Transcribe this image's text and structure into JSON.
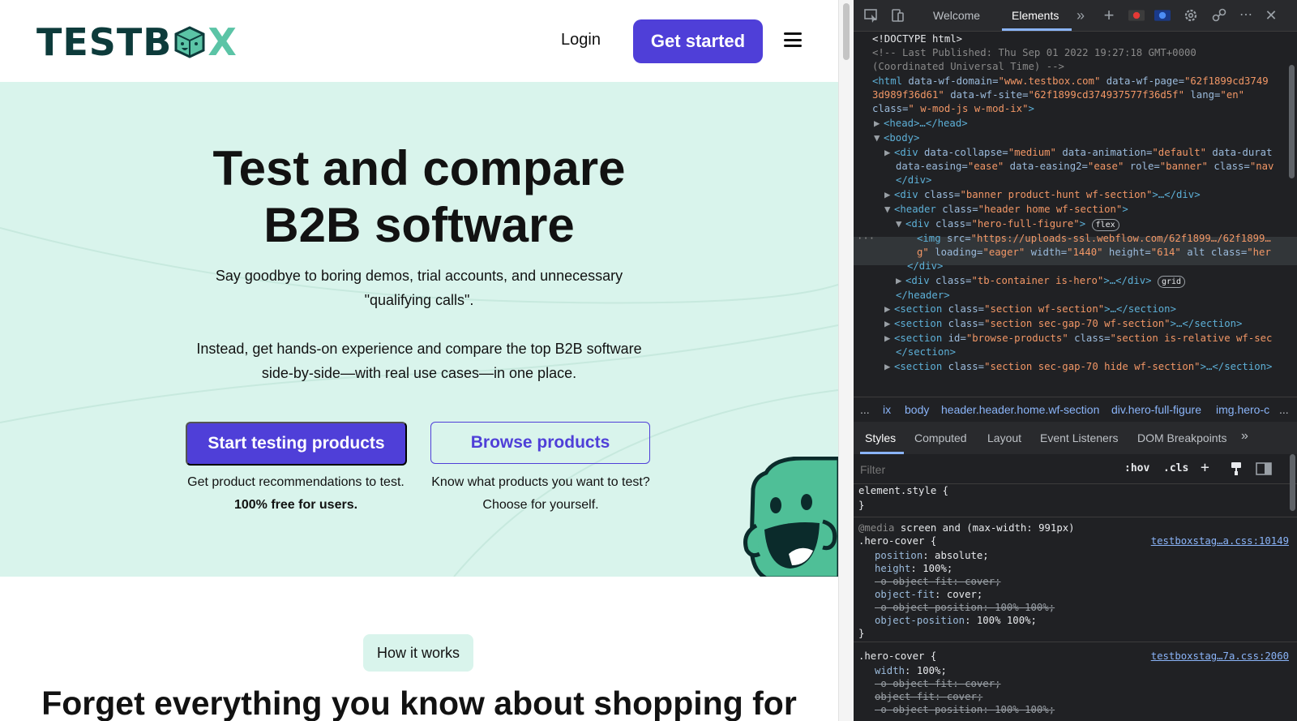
{
  "site": {
    "logo": {
      "text_before": "TESTB",
      "text_after": "X"
    },
    "nav": {
      "login": "Login",
      "get_started": "Get started"
    },
    "hero": {
      "title_line1": "Test and compare",
      "title_line2": "B2B software",
      "subtitle_line1": "Say goodbye to boring demos, trial accounts, and unnecessary",
      "subtitle_line2": "\"qualifying calls\".",
      "body_line1": "Instead, get hands-on experience and compare the top B2B software",
      "body_line2": "side-by-side—with real use cases—in one place.",
      "start_button": "Start testing products",
      "browse_button": "Browse products",
      "start_caption_line1": "Get product recommendations to test.",
      "start_caption_line2": "100% free for users.",
      "browse_caption_line1": "Know what products you want to test?",
      "browse_caption_line2": "Choose for yourself."
    },
    "how_it_works": "How it works",
    "section_heading": "Forget everything you know about shopping for",
    "colors": {
      "primary": "#4f3fd8",
      "hero_bg": "#d9f4ec",
      "brand_dark": "#0d3b3b",
      "brand_green": "#5bc4a6"
    }
  },
  "devtools": {
    "tabs": [
      "Welcome",
      "Elements"
    ],
    "active_tab": "Elements",
    "dom": {
      "doctype": "<!DOCTYPE html>",
      "comment1": "<!-- Last Published: Thu Sep 01 2022 19:27:18 GMT+0000",
      "comment2": "(Coordinated Universal Time) -->",
      "html_line1_pre": "data-wf-domain=",
      "html_domain": "\"www.testbox.com\"",
      "html_page_attr": " data-wf-page=",
      "html_page_val": "\"62f1899cd3749",
      "html_line2_a": "3d989f36d61\"",
      "html_line2_attr": " data-wf-site=",
      "html_line2_val": "\"62f1899cd374937577f36d5f\"",
      "html_line2_lang": " lang=",
      "html_line2_langval": "\"en\"",
      "html_line3_attr": "class=",
      "html_line3_val": "\" w-mod-js w-mod-ix\"",
      "head": "<head>…</head>",
      "body": "<body>",
      "div_line1_attrs": " data-collapse=",
      "div_line1_v1": "\"medium\"",
      "div_line1_a2": " data-animation=",
      "div_line1_v2": "\"default\"",
      "div_line1_a3": " data-durat",
      "div_line2_a1": "data-easing=",
      "div_line2_v1": "\"ease\"",
      "div_line2_a2": " data-easing2=",
      "div_line2_v2": "\"ease\"",
      "div_line2_a3": " role=",
      "div_line2_v3": "\"banner\"",
      "div_line2_a4": " class=",
      "div_line2_v4": "\"nav",
      "div_close": "</div>",
      "banner_val": "\"banner product-hunt wf-section\"",
      "header_val": "\"header home wf-section\"",
      "hero_figure_val": "\"hero-full-figure\"",
      "pill_flex": "flex",
      "img_src_val": "\"https://uploads-ssl.webflow.com/62f1899…/62f1899…",
      "img_line2_a": "g\"",
      "img_loading_val": "\"eager\"",
      "img_width_val": "\"1440\"",
      "img_height_val": "\"614\"",
      "img_alt": " alt class=",
      "img_class_val": "\"her",
      "tb_container_val": "\"tb-container is-hero\"",
      "pill_grid": "grid",
      "header_close": "</header>",
      "section1_val": "\"section wf-section\"",
      "section2_val": "\"section sec-gap-70 wf-section\"",
      "section3_id": "\"browse-products\"",
      "section3_class": "\"section is-relative wf-sec",
      "section_close": "</section>",
      "section4_val": "\"section sec-gap-70 hide wf-section\""
    },
    "breadcrumbs": [
      "...",
      "ix",
      "body",
      "header.header.home.wf-section",
      "div.hero-full-figure",
      "img.hero-c",
      "..."
    ],
    "subtabs": [
      "Styles",
      "Computed",
      "Layout",
      "Event Listeners",
      "DOM Breakpoints"
    ],
    "active_subtab": "Styles",
    "filter_placeholder": "Filter",
    "filter_buttons": [
      ":hov",
      ".cls"
    ],
    "styles": {
      "element_style": "element.style {",
      "close_brace": "}",
      "media_query": "screen and (max-width: 991px)",
      "media_at": "@media",
      "rule1_selector": ".hero-cover {",
      "rule1_source": "testboxstag…a.css:10149",
      "rule1_props": [
        {
          "name": "position",
          "value": "absolute",
          "struck": false
        },
        {
          "name": "height",
          "value": "100%",
          "struck": false
        },
        {
          "name": "-o-object-fit",
          "value": "cover",
          "struck": true
        },
        {
          "name": "object-fit",
          "value": "cover",
          "struck": false
        },
        {
          "name": "-o-object-position",
          "value": "100% 100%",
          "struck": true
        },
        {
          "name": "object-position",
          "value": "100% 100%",
          "struck": false
        }
      ],
      "rule2_selector": ".hero-cover {",
      "rule2_source": "testboxstag…7a.css:2060",
      "rule2_props": [
        {
          "name": "width",
          "value": "100%",
          "struck": false
        },
        {
          "name": "-o-object-fit",
          "value": "cover",
          "struck": true
        },
        {
          "name": "object-fit",
          "value": "cover",
          "struck": true
        },
        {
          "name": "-o-object-position",
          "value": "100% 100%",
          "struck": true
        }
      ]
    },
    "colors": {
      "panel_bg": "#202124",
      "tag": "#5db0d7",
      "attr_value": "#f29766",
      "link": "#8ab4f8"
    }
  }
}
